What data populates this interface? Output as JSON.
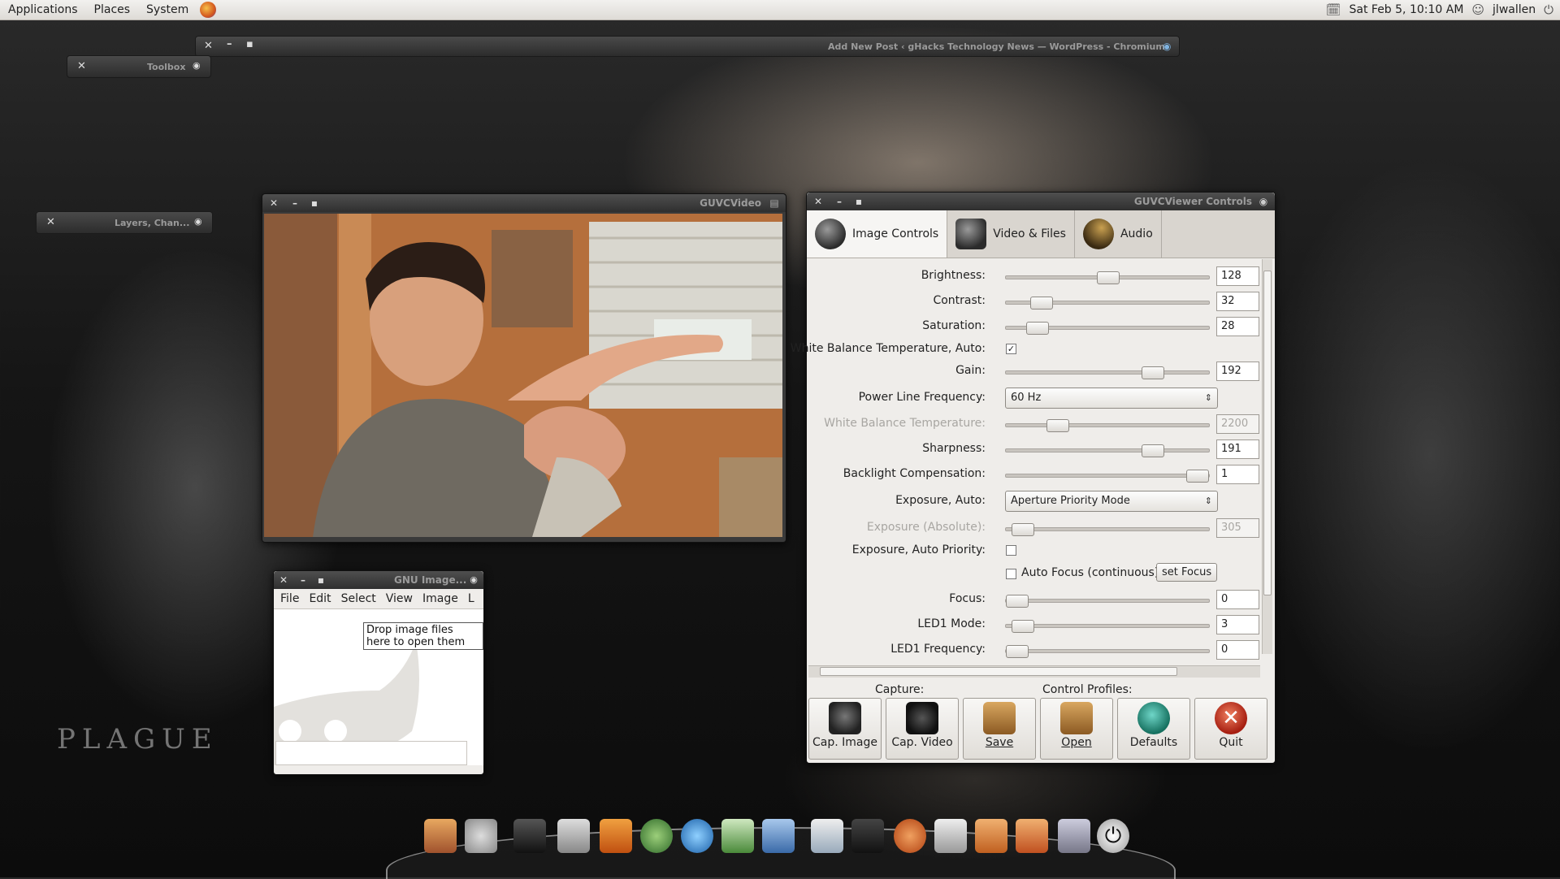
{
  "top_panel": {
    "menus": [
      "Applications",
      "Places",
      "System"
    ],
    "datetime": "Sat Feb  5, 10:10 AM",
    "username": "jlwallen"
  },
  "desktop": {
    "wallpaper_text": "PLAGUE"
  },
  "mini_windows": {
    "toolbox": "Toolbox",
    "layers": "Layers, Chan...",
    "chromium": "Add New Post ‹ gHacks Technology News — WordPress - Chromium"
  },
  "guvcvideo": {
    "title": "GUVCVideo"
  },
  "controls": {
    "title": "GUVCViewer Controls",
    "tabs": [
      "Image Controls",
      "Video & Files",
      "Audio"
    ],
    "brightness": {
      "label": "Brightness:",
      "value": "128",
      "level": 0.5
    },
    "contrast": {
      "label": "Contrast:",
      "value": "32",
      "level": 0.17
    },
    "saturation": {
      "label": "Saturation:",
      "value": "28",
      "level": 0.15
    },
    "wb_auto": {
      "label": "White Balance Temperature, Auto:",
      "checked": true
    },
    "gain": {
      "label": "Gain:",
      "value": "192",
      "level": 0.72
    },
    "power_line": {
      "label": "Power Line Frequency:",
      "value": "60 Hz"
    },
    "wb_temp": {
      "label": "White Balance Temperature:",
      "value": "2200",
      "level": 0.25
    },
    "sharpness": {
      "label": "Sharpness:",
      "value": "191",
      "level": 0.72
    },
    "backlight": {
      "label": "Backlight Compensation:",
      "value": "1",
      "level": 0.94
    },
    "exposure_auto": {
      "label": "Exposure, Auto:",
      "value": "Aperture Priority Mode"
    },
    "exposure_abs": {
      "label": "Exposure (Absolute):",
      "value": "305",
      "level": 0.08
    },
    "exposure_priority": {
      "label": "Exposure, Auto Priority:",
      "checked": false
    },
    "autofocus": {
      "label": "Auto Focus (continuous)",
      "checked": false,
      "button": "set Focus"
    },
    "focus": {
      "label": "Focus:",
      "value": "0",
      "level": 0.05
    },
    "led1_mode": {
      "label": "LED1 Mode:",
      "value": "3",
      "level": 0.08
    },
    "led1_freq": {
      "label": "LED1 Frequency:",
      "value": "0",
      "level": 0.05
    },
    "capture_label": "Capture:",
    "profiles_label": "Control Profiles:",
    "buttons": [
      "Cap. Image",
      "Cap. Video",
      "Save",
      "Open",
      "Defaults",
      "Quit"
    ]
  },
  "gimp": {
    "title": "GNU Image...",
    "menus": [
      "File",
      "Edit",
      "Select",
      "View",
      "Image",
      "L"
    ],
    "drop_text": "Drop image files here to open them"
  }
}
